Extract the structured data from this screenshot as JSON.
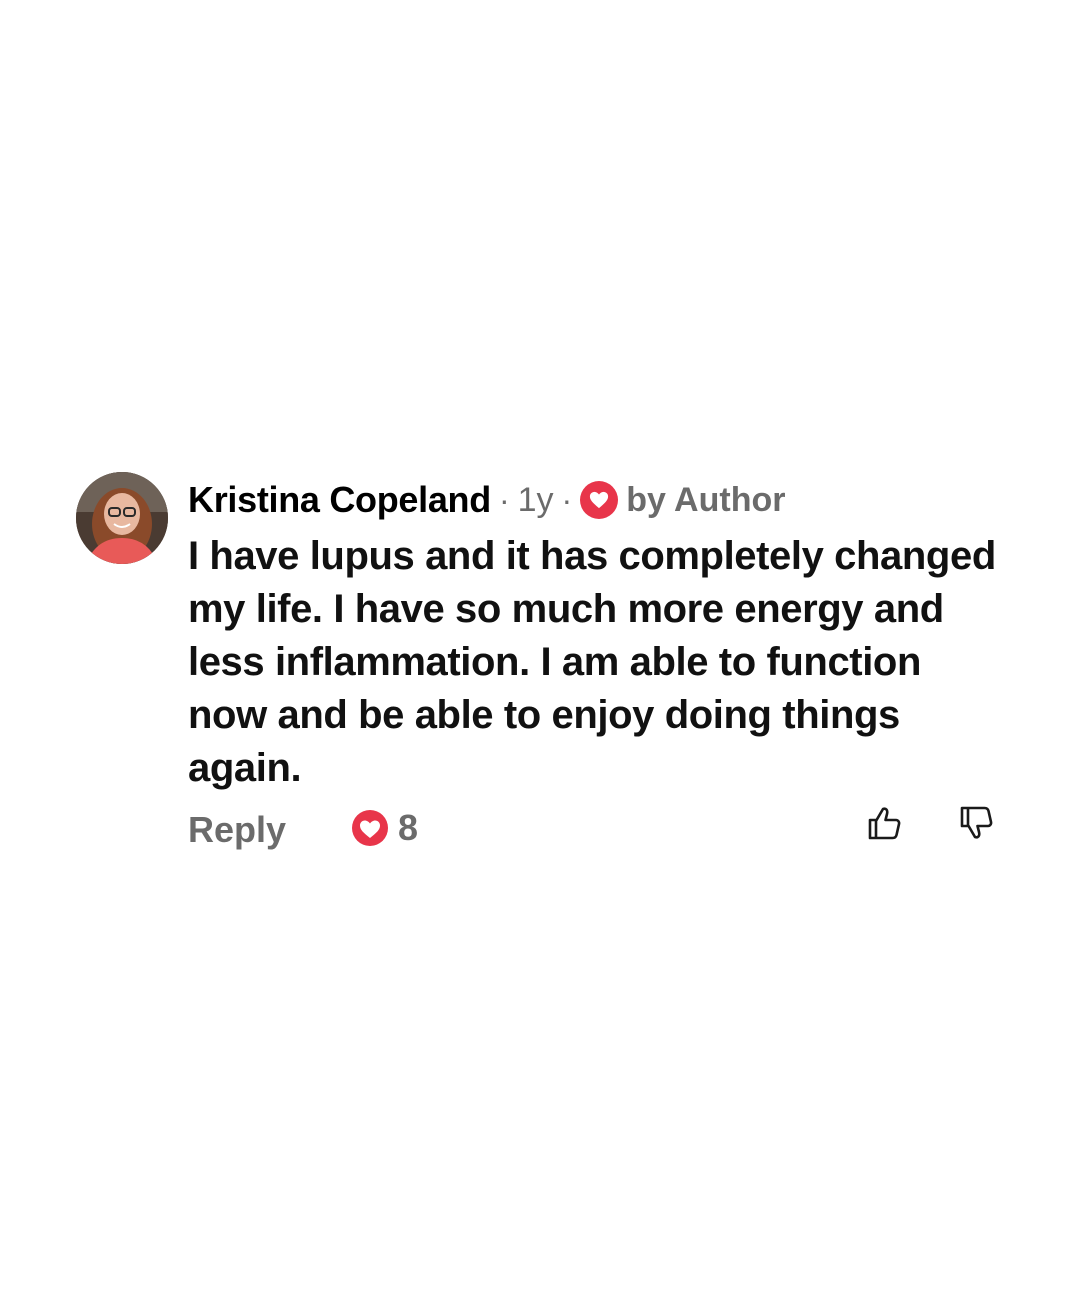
{
  "comment": {
    "author": "Kristina Copeland",
    "separator": "·",
    "age": "1y",
    "author_badge": "by Author",
    "text": "I have lupus and it has completely changed my life. I have so much more energy and less inflammation. I am able to function now and be able to enjoy doing things again.",
    "reply_label": "Reply",
    "like_count": "8",
    "icons": {
      "avatar": "avatar",
      "author_heart": "heart-icon",
      "like_heart": "heart-icon",
      "thumb_up": "thumbs-up-icon",
      "thumb_down": "thumbs-down-icon"
    },
    "colors": {
      "heart": "#e8354a",
      "muted_text": "#6b6b6b",
      "body_text": "#111111"
    }
  }
}
